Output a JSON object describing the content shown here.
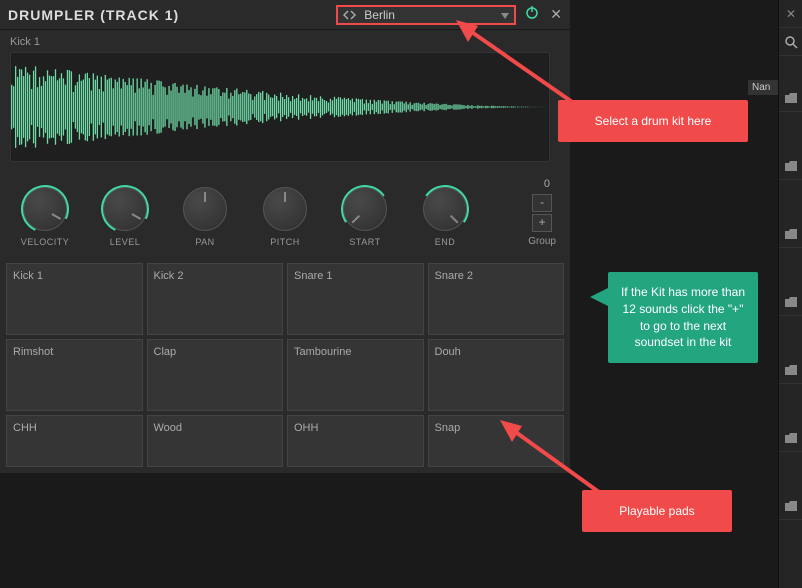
{
  "header": {
    "title": "DRUMPLER (TRACK 1)",
    "preset": "Berlin"
  },
  "sample": {
    "name": "Kick 1"
  },
  "knobs": [
    {
      "label": "VELOCITY"
    },
    {
      "label": "LEVEL"
    },
    {
      "label": "PAN"
    },
    {
      "label": "PITCH"
    },
    {
      "label": "START"
    },
    {
      "label": "END"
    }
  ],
  "group": {
    "index": "0",
    "label": "Group",
    "minus": "-",
    "plus": "+"
  },
  "pads": [
    "Kick 1",
    "Kick 2",
    "Snare 1",
    "Snare 2",
    "Rimshot",
    "Clap",
    "Tambourine",
    "Douh",
    "CHH",
    "Wood",
    "OHH",
    "Snap"
  ],
  "side": {
    "nan_label": "Nan"
  },
  "callouts": {
    "top": "Select a drum kit here",
    "mid": "If the Kit has more than 12 sounds click the \"+\"  to go to the next soundset in the kit",
    "bottom": "Playable pads"
  }
}
